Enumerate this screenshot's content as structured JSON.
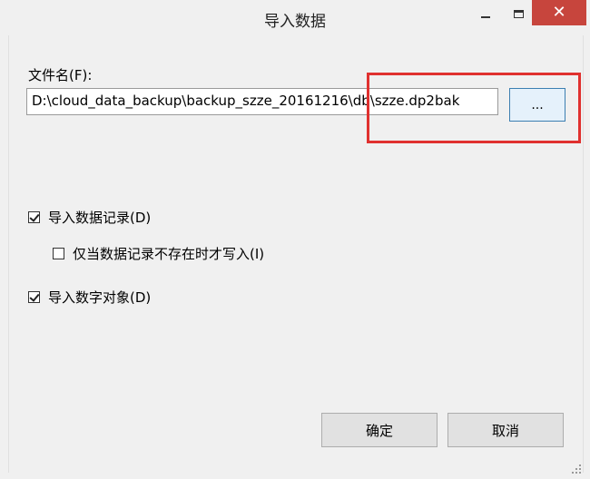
{
  "window": {
    "title": "导入数据",
    "close_glyph": "✕"
  },
  "file": {
    "label": "文件名(F):",
    "value": "D:\\cloud_data_backup\\backup_szze_20161216\\db\\szze.dp2bak",
    "browse_label": "..."
  },
  "options": [
    {
      "label": "导入数据记录(D)",
      "checked": true
    },
    {
      "label": "仅当数据记录不存在时才写入(I)",
      "checked": false
    },
    {
      "label": "导入数字对象(D)",
      "checked": true
    }
  ],
  "buttons": {
    "ok": "确定",
    "cancel": "取消"
  },
  "colors": {
    "close_button": "#c7453d",
    "highlight": "#e0312f",
    "browse_border": "#3c7fb1"
  }
}
